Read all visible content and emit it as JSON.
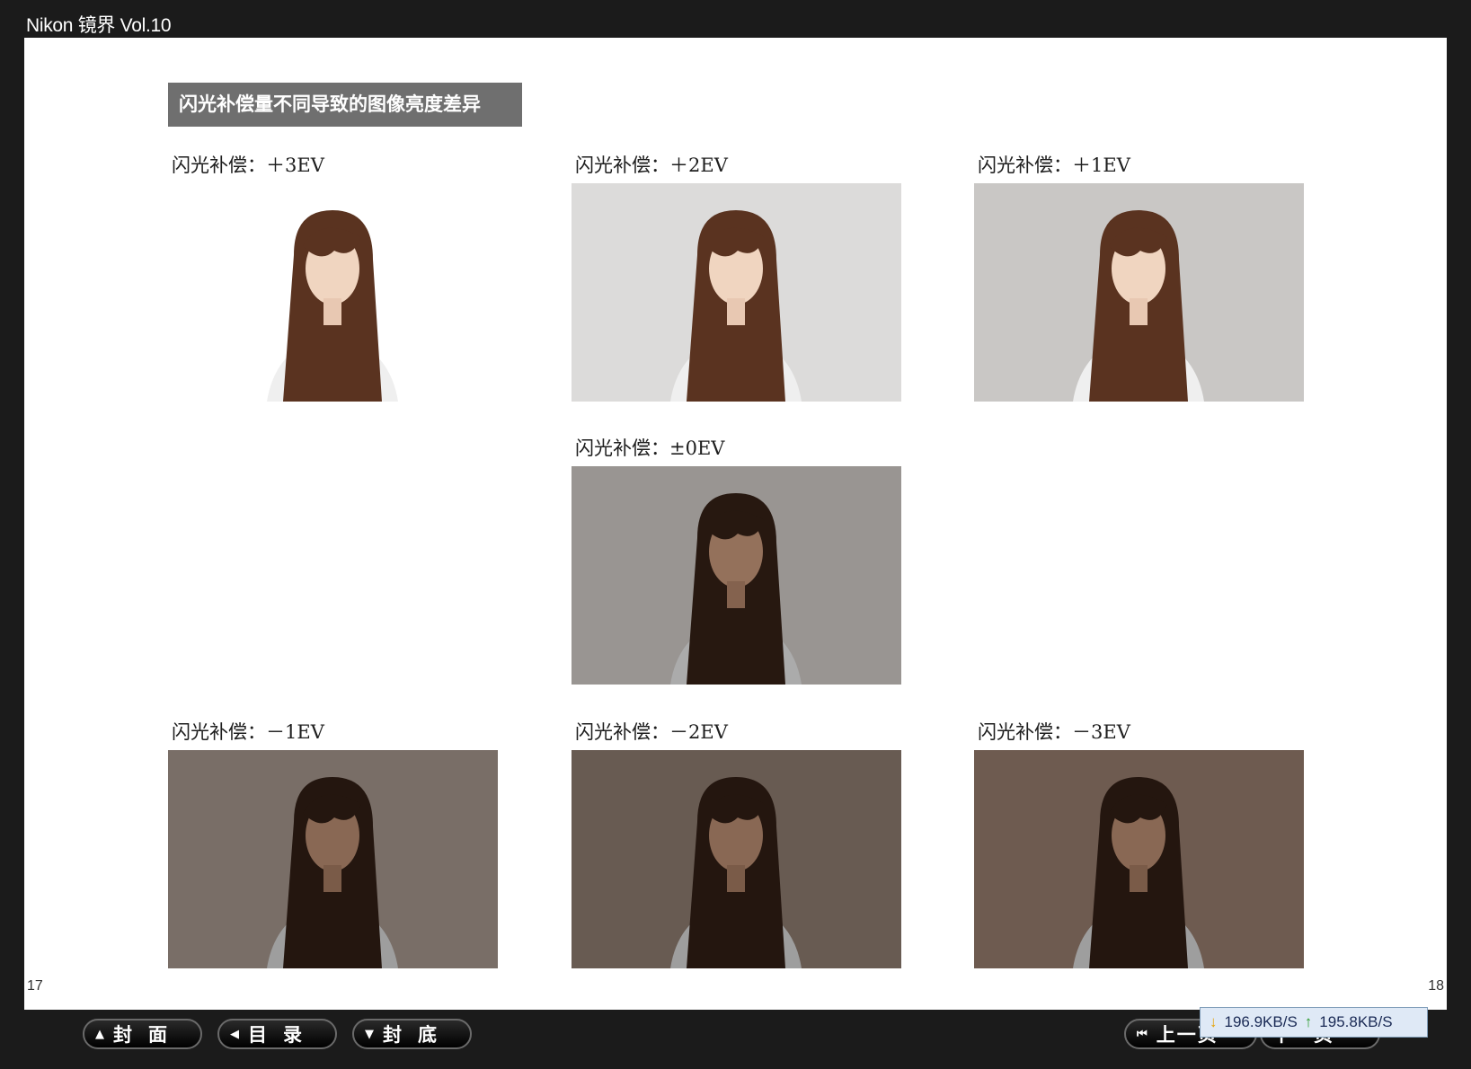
{
  "app": {
    "title": "Nikon 镜界 Vol.10"
  },
  "section_title": "闪光补偿量不同导致的图像亮度差异",
  "photos": [
    {
      "caption": "闪光补偿：＋3EV",
      "bg": "#ffffff"
    },
    {
      "caption": "闪光补偿：＋2EV",
      "bg": "#dcdbda"
    },
    {
      "caption": "闪光补偿：＋1EV",
      "bg": "#c9c7c5"
    },
    {
      "caption": "闪光补偿：±0EV",
      "bg": "#a5a19e"
    },
    {
      "caption": "闪光补偿：－1EV",
      "bg": "#8d8078"
    },
    {
      "caption": "闪光补偿：－2EV",
      "bg": "#7a6a60"
    },
    {
      "caption": "闪光补偿：－3EV",
      "bg": "#806a5e"
    }
  ],
  "pages": {
    "left": "17",
    "right": "18"
  },
  "nav": {
    "cover": "封面",
    "toc": "目录",
    "back_cover": "封底",
    "prev": "上一页",
    "next": "下一页"
  },
  "speed": {
    "down": "196.9KB/S",
    "up": "195.8KB/S"
  }
}
